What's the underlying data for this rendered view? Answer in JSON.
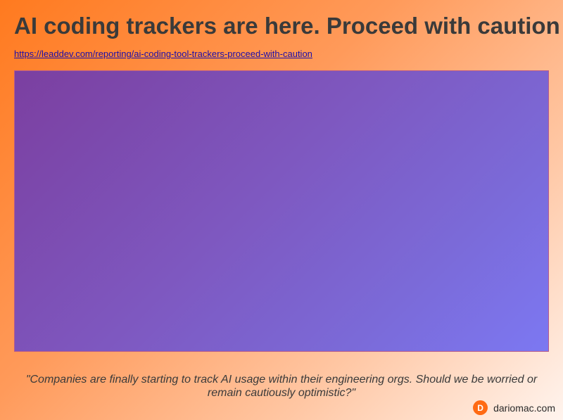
{
  "page": {
    "title": "AI coding trackers are here. Proceed with caution",
    "link": {
      "text": "https://leaddev.com/reporting/ai-coding-tool-trackers-proceed-with-caution",
      "href": "https://leaddev.com/reporting/ai-coding-tool-trackers-proceed-with-caution"
    },
    "quote": "\"Companies are finally starting to track AI usage within their engineering orgs. Should we be worried or remain cautiously optimistic?\""
  },
  "brand": {
    "logo_letter": "D",
    "logo_icon": "brand-logo-icon",
    "name": "dariomac.com"
  },
  "colors": {
    "background_start": "#ff7a1f",
    "background_end": "#fff4ee",
    "hero_start": "#7b3fa0",
    "hero_end": "#7c78f2",
    "title_text": "#3a3a3a",
    "link": "#1a0dab",
    "brand_logo": "#ff6a13"
  }
}
